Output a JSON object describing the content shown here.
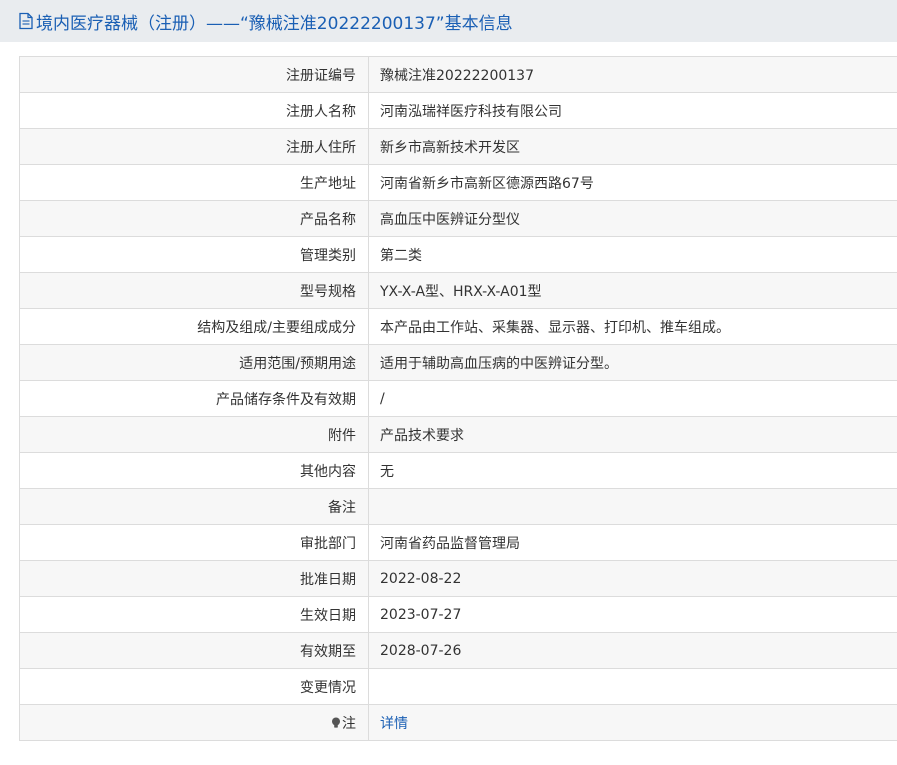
{
  "header": {
    "title": "境内医疗器械（注册）——“豫械注准20222200137”基本信息",
    "icon": "document-icon"
  },
  "rows": [
    {
      "label": "注册证编号",
      "value": "豫械注准20222200137"
    },
    {
      "label": "注册人名称",
      "value": "河南泓瑞祥医疗科技有限公司"
    },
    {
      "label": "注册人住所",
      "value": "新乡市高新技术开发区"
    },
    {
      "label": "生产地址",
      "value": "河南省新乡市高新区德源西路67号"
    },
    {
      "label": "产品名称",
      "value": "高血压中医辨证分型仪"
    },
    {
      "label": "管理类别",
      "value": "第二类"
    },
    {
      "label": "型号规格",
      "value": "YX-X-A型、HRX-X-A01型"
    },
    {
      "label": "结构及组成/主要组成成分",
      "value": "本产品由工作站、采集器、显示器、打印机、推车组成。"
    },
    {
      "label": "适用范围/预期用途",
      "value": "适用于辅助高血压病的中医辨证分型。"
    },
    {
      "label": "产品储存条件及有效期",
      "value": "/"
    },
    {
      "label": "附件",
      "value": "产品技术要求"
    },
    {
      "label": "其他内容",
      "value": "无"
    },
    {
      "label": "备注",
      "value": ""
    },
    {
      "label": "审批部门",
      "value": "河南省药品监督管理局"
    },
    {
      "label": "批准日期",
      "value": "2022-08-22"
    },
    {
      "label": "生效日期",
      "value": "2023-07-27"
    },
    {
      "label": "有效期至",
      "value": "2028-07-26"
    },
    {
      "label": "变更情况",
      "value": ""
    }
  ],
  "note_row": {
    "label": "注",
    "icon": "lightbulb-icon",
    "link_text": "详情"
  },
  "colors": {
    "title_bar_bg": "#e9ecef",
    "title_text": "#1a5fb4",
    "link": "#1a5fb4",
    "border": "#dcdcdc",
    "row_alt_bg": "#f7f7f7"
  }
}
